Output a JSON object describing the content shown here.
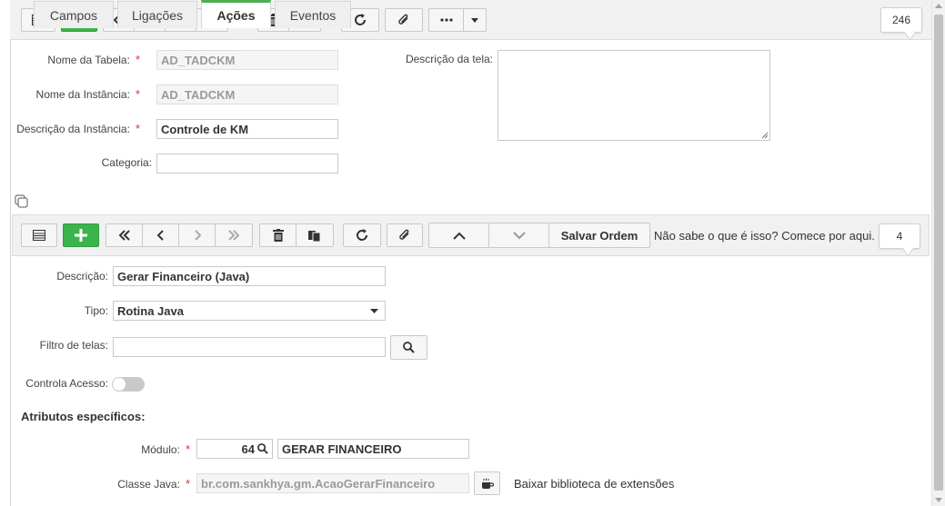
{
  "top_counter": "246",
  "form": {
    "table_name_label": "Nome da Tabela:",
    "table_name_value": "AD_TADCKM",
    "instance_name_label": "Nome da Instância:",
    "instance_name_value": "AD_TADCKM",
    "instance_desc_label": "Descrição da Instância:",
    "instance_desc_value": "Controle de KM",
    "category_label": "Categoria:",
    "category_value": "",
    "screen_desc_label": "Descrição da tela:",
    "required_mark": "*"
  },
  "tabs": [
    "Campos",
    "Ligações",
    "Ações",
    "Eventos"
  ],
  "active_tab": "Ações",
  "sub_toolbar": {
    "save_order_label": "Salvar Ordem",
    "help_text": "Não sabe o que é isso? Comece por aqui.",
    "counter": "4"
  },
  "detail": {
    "description_label": "Descrição:",
    "description_value": "Gerar Financeiro (Java)",
    "type_label": "Tipo:",
    "type_value": "Rotina Java",
    "screen_filter_label": "Filtro de telas:",
    "screen_filter_value": "",
    "access_control_label": "Controla Acesso:",
    "specific_attrs_title": "Atributos específicos:",
    "module_label": "Módulo:",
    "module_code": "64",
    "module_name": "GERAR FINANCEIRO",
    "java_class_label": "Classe Java:",
    "java_class_value": "br.com.sankhya.gm.AcaoGerarFinanceiro",
    "download_ext_label": "Baixar biblioteca de extensões"
  },
  "colors": {
    "accent_green": "#3cb44b",
    "required_red": "#d9322b"
  }
}
